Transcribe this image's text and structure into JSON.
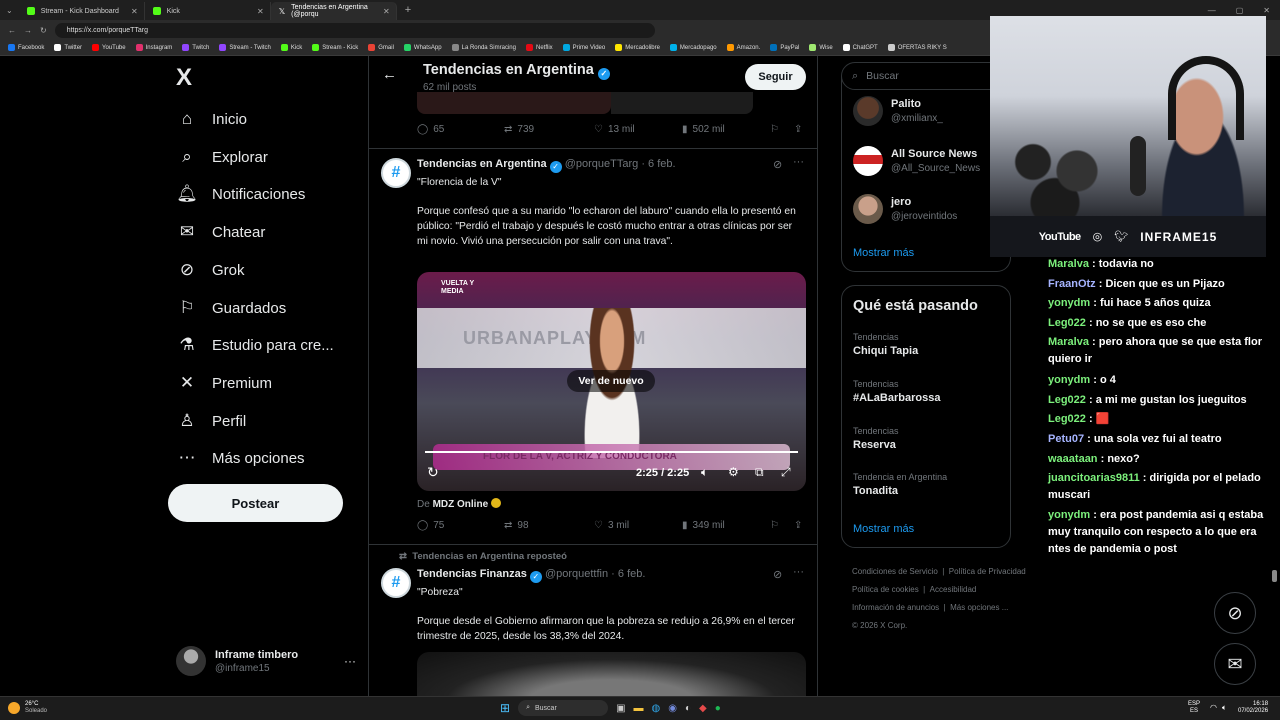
{
  "browser": {
    "tabs": [
      {
        "label": "Stream - Kick Dashboard",
        "color": "#53fc18"
      },
      {
        "label": "Kick",
        "color": "#53fc18"
      },
      {
        "label": "Tendencias en Argentina (@porqu",
        "color": "#ffffff"
      }
    ],
    "url": "https://x.com/porqueTTarg",
    "bookmarks": [
      {
        "label": "Facebook",
        "color": "#1877f2"
      },
      {
        "label": "Twitter",
        "color": "#ffffff"
      },
      {
        "label": "YouTube",
        "color": "#ff0000"
      },
      {
        "label": "Instagram",
        "color": "#e1306c"
      },
      {
        "label": "Twitch",
        "color": "#9146ff"
      },
      {
        "label": "Stream - Twitch",
        "color": "#9146ff"
      },
      {
        "label": "Kick",
        "color": "#53fc18"
      },
      {
        "label": "Stream - Kick",
        "color": "#53fc18"
      },
      {
        "label": "Gmail",
        "color": "#ea4335"
      },
      {
        "label": "WhatsApp",
        "color": "#25d366"
      },
      {
        "label": "La Ronda Simracing",
        "color": "#888888"
      },
      {
        "label": "Netflix",
        "color": "#e50914"
      },
      {
        "label": "Prime Video",
        "color": "#00a8e1"
      },
      {
        "label": "Mercadolibre",
        "color": "#ffe600"
      },
      {
        "label": "Mercadopago",
        "color": "#00b1ea"
      },
      {
        "label": "Amazon.",
        "color": "#ff9900"
      },
      {
        "label": "PayPal",
        "color": "#0070ba"
      },
      {
        "label": "Wise",
        "color": "#9fe870"
      },
      {
        "label": "ChatGPT",
        "color": "#ffffff"
      },
      {
        "label": "OFERTAS RIKY S",
        "color": "#cccccc"
      }
    ]
  },
  "nav": {
    "logo": "X",
    "items": [
      {
        "label": "Inicio",
        "icon": "⌂"
      },
      {
        "label": "Explorar",
        "icon": "⌕"
      },
      {
        "label": "Notificaciones",
        "icon": "🔔︎"
      },
      {
        "label": "Chatear",
        "icon": "✉︎"
      },
      {
        "label": "Grok",
        "icon": "⊘"
      },
      {
        "label": "Guardados",
        "icon": "⚐"
      },
      {
        "label": "Estudio para cre...",
        "icon": "⚗"
      },
      {
        "label": "Premium",
        "icon": "✕"
      },
      {
        "label": "Perfil",
        "icon": "♙"
      },
      {
        "label": "Más opciones",
        "icon": "⋯"
      }
    ],
    "post_button": "Postear",
    "account_name": "Inframe timbero",
    "account_handle": "@inframe15",
    "account_more": "···"
  },
  "header": {
    "title": "Tendencias en Argentina",
    "subtitle": "62 mil posts",
    "follow": "Seguir",
    "back": "←"
  },
  "tweet0": {
    "replies": "65",
    "reposts": "739",
    "likes": "13 mil",
    "views": "502 mil"
  },
  "tweet1": {
    "name": "Tendencias en Argentina",
    "handle": "@porqueTTarg",
    "date": "· 6 feb.",
    "line1": "\"Florencia de la V\"",
    "body": "Porque confesó que a su marido \"lo echaron del laburo\" cuando ella lo presentó en público: \"Perdió el trabajo y después le costó mucho entrar a otras clínicas por ser mi novio. Vivió una persecución por salir con una trava\".",
    "video_banner": "URBANAPLAY.COM",
    "video_ticker": "FLOR DE LA V, ACTRIZ Y CONDUCTORA",
    "video_corner": "VUELTA Y MEDIA",
    "replay": "Ver de nuevo",
    "time": "2:25 / 2:25",
    "source_prefix": "De",
    "source": "MDZ Online",
    "replies": "75",
    "reposts": "98",
    "likes": "3 mil",
    "views": "349 mil",
    "progress": 1.0
  },
  "tweet2": {
    "repost_label": "Tendencias en Argentina reposteó",
    "name": "Tendencias Finanzas",
    "handle": "@porquettfin",
    "date": "· 6 feb.",
    "line1": "\"Pobreza\"",
    "body": "Porque desde el Gobierno afirmaron que la pobreza se redujo a 26,9% en el tercer trimestre de 2025, desde los 38,3% del 2024."
  },
  "right": {
    "search_placeholder": "Buscar",
    "who_to_follow": [
      {
        "name": "Palito",
        "handle": "@xmilianx_"
      },
      {
        "name": "All Source News",
        "handle": "@All_Source_News"
      },
      {
        "name": "jero",
        "handle": "@jeroveintidos"
      }
    ],
    "show_more_1": "Mostrar más",
    "trends_title": "Qué está pasando",
    "trends": [
      {
        "cat": "Tendencias",
        "name": "Chiqui Tapia"
      },
      {
        "cat": "Tendencias",
        "name": "#ALaBarbarossa"
      },
      {
        "cat": "Tendencias",
        "name": "Reserva"
      },
      {
        "cat": "Tendencia en Argentina",
        "name": "Tonadita"
      }
    ],
    "show_more_2": "Mostrar más",
    "footer": [
      "Condiciones de Servicio",
      "Política de Privacidad",
      "Política de cookies",
      "Accesibilidad",
      "Información de anuncios",
      "Más opciones ...",
      "© 2026 X Corp."
    ]
  },
  "stream": {
    "social": [
      "YouTube",
      "INFRAME15"
    ],
    "chat": [
      {
        "user": "Maralva",
        "msg": ": todavia no"
      },
      {
        "user": "FraanOtz",
        "msg": ": Dicen que es un Pijazo"
      },
      {
        "user": "yonydm",
        "msg": ": fui hace 5 años quiza"
      },
      {
        "user": "Leg022",
        "msg": ": no se que es eso che"
      },
      {
        "user": "Maralva",
        "msg": ": pero ahora que se que esta flor quiero ir"
      },
      {
        "user": "yonydm",
        "msg": ": o 4"
      },
      {
        "user": "Leg022",
        "msg": ": a mi me gustan los jueguitos"
      },
      {
        "user": "Leg022",
        "msg": ": 🟥"
      },
      {
        "user": "Petu07",
        "msg": ": una sola vez fui al teatro"
      },
      {
        "user": "waaataan",
        "msg": ": nexo?"
      },
      {
        "user": "juancitoarias9811",
        "msg": ": dirigida por el pelado muscari"
      },
      {
        "user": "yonydm",
        "msg": ": era post pandemia asi q estaba muy tranquilo con respecto a lo que era ntes de pandemia o post"
      }
    ]
  },
  "taskbar": {
    "weather_temp": "26°C",
    "weather_desc": "Soleado",
    "search": "Buscar",
    "lang1": "ESP",
    "lang2": "ES",
    "time": "16:18",
    "date": "07/02/2026"
  }
}
